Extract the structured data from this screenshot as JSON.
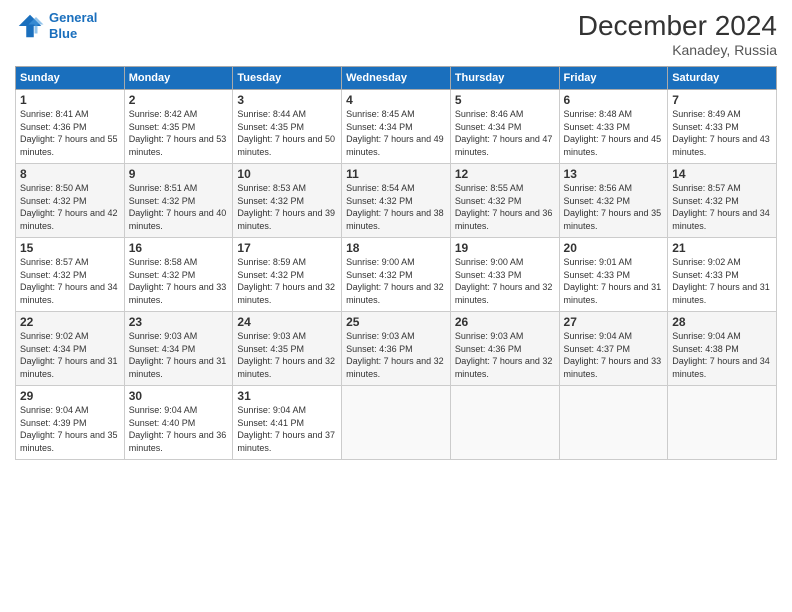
{
  "header": {
    "logo_line1": "General",
    "logo_line2": "Blue",
    "title": "December 2024",
    "subtitle": "Kanadey, Russia"
  },
  "columns": [
    "Sunday",
    "Monday",
    "Tuesday",
    "Wednesday",
    "Thursday",
    "Friday",
    "Saturday"
  ],
  "weeks": [
    [
      {
        "day": "1",
        "sunrise": "Sunrise: 8:41 AM",
        "sunset": "Sunset: 4:36 PM",
        "daylight": "Daylight: 7 hours and 55 minutes."
      },
      {
        "day": "2",
        "sunrise": "Sunrise: 8:42 AM",
        "sunset": "Sunset: 4:35 PM",
        "daylight": "Daylight: 7 hours and 53 minutes."
      },
      {
        "day": "3",
        "sunrise": "Sunrise: 8:44 AM",
        "sunset": "Sunset: 4:35 PM",
        "daylight": "Daylight: 7 hours and 50 minutes."
      },
      {
        "day": "4",
        "sunrise": "Sunrise: 8:45 AM",
        "sunset": "Sunset: 4:34 PM",
        "daylight": "Daylight: 7 hours and 49 minutes."
      },
      {
        "day": "5",
        "sunrise": "Sunrise: 8:46 AM",
        "sunset": "Sunset: 4:34 PM",
        "daylight": "Daylight: 7 hours and 47 minutes."
      },
      {
        "day": "6",
        "sunrise": "Sunrise: 8:48 AM",
        "sunset": "Sunset: 4:33 PM",
        "daylight": "Daylight: 7 hours and 45 minutes."
      },
      {
        "day": "7",
        "sunrise": "Sunrise: 8:49 AM",
        "sunset": "Sunset: 4:33 PM",
        "daylight": "Daylight: 7 hours and 43 minutes."
      }
    ],
    [
      {
        "day": "8",
        "sunrise": "Sunrise: 8:50 AM",
        "sunset": "Sunset: 4:32 PM",
        "daylight": "Daylight: 7 hours and 42 minutes."
      },
      {
        "day": "9",
        "sunrise": "Sunrise: 8:51 AM",
        "sunset": "Sunset: 4:32 PM",
        "daylight": "Daylight: 7 hours and 40 minutes."
      },
      {
        "day": "10",
        "sunrise": "Sunrise: 8:53 AM",
        "sunset": "Sunset: 4:32 PM",
        "daylight": "Daylight: 7 hours and 39 minutes."
      },
      {
        "day": "11",
        "sunrise": "Sunrise: 8:54 AM",
        "sunset": "Sunset: 4:32 PM",
        "daylight": "Daylight: 7 hours and 38 minutes."
      },
      {
        "day": "12",
        "sunrise": "Sunrise: 8:55 AM",
        "sunset": "Sunset: 4:32 PM",
        "daylight": "Daylight: 7 hours and 36 minutes."
      },
      {
        "day": "13",
        "sunrise": "Sunrise: 8:56 AM",
        "sunset": "Sunset: 4:32 PM",
        "daylight": "Daylight: 7 hours and 35 minutes."
      },
      {
        "day": "14",
        "sunrise": "Sunrise: 8:57 AM",
        "sunset": "Sunset: 4:32 PM",
        "daylight": "Daylight: 7 hours and 34 minutes."
      }
    ],
    [
      {
        "day": "15",
        "sunrise": "Sunrise: 8:57 AM",
        "sunset": "Sunset: 4:32 PM",
        "daylight": "Daylight: 7 hours and 34 minutes."
      },
      {
        "day": "16",
        "sunrise": "Sunrise: 8:58 AM",
        "sunset": "Sunset: 4:32 PM",
        "daylight": "Daylight: 7 hours and 33 minutes."
      },
      {
        "day": "17",
        "sunrise": "Sunrise: 8:59 AM",
        "sunset": "Sunset: 4:32 PM",
        "daylight": "Daylight: 7 hours and 32 minutes."
      },
      {
        "day": "18",
        "sunrise": "Sunrise: 9:00 AM",
        "sunset": "Sunset: 4:32 PM",
        "daylight": "Daylight: 7 hours and 32 minutes."
      },
      {
        "day": "19",
        "sunrise": "Sunrise: 9:00 AM",
        "sunset": "Sunset: 4:33 PM",
        "daylight": "Daylight: 7 hours and 32 minutes."
      },
      {
        "day": "20",
        "sunrise": "Sunrise: 9:01 AM",
        "sunset": "Sunset: 4:33 PM",
        "daylight": "Daylight: 7 hours and 31 minutes."
      },
      {
        "day": "21",
        "sunrise": "Sunrise: 9:02 AM",
        "sunset": "Sunset: 4:33 PM",
        "daylight": "Daylight: 7 hours and 31 minutes."
      }
    ],
    [
      {
        "day": "22",
        "sunrise": "Sunrise: 9:02 AM",
        "sunset": "Sunset: 4:34 PM",
        "daylight": "Daylight: 7 hours and 31 minutes."
      },
      {
        "day": "23",
        "sunrise": "Sunrise: 9:03 AM",
        "sunset": "Sunset: 4:34 PM",
        "daylight": "Daylight: 7 hours and 31 minutes."
      },
      {
        "day": "24",
        "sunrise": "Sunrise: 9:03 AM",
        "sunset": "Sunset: 4:35 PM",
        "daylight": "Daylight: 7 hours and 32 minutes."
      },
      {
        "day": "25",
        "sunrise": "Sunrise: 9:03 AM",
        "sunset": "Sunset: 4:36 PM",
        "daylight": "Daylight: 7 hours and 32 minutes."
      },
      {
        "day": "26",
        "sunrise": "Sunrise: 9:03 AM",
        "sunset": "Sunset: 4:36 PM",
        "daylight": "Daylight: 7 hours and 32 minutes."
      },
      {
        "day": "27",
        "sunrise": "Sunrise: 9:04 AM",
        "sunset": "Sunset: 4:37 PM",
        "daylight": "Daylight: 7 hours and 33 minutes."
      },
      {
        "day": "28",
        "sunrise": "Sunrise: 9:04 AM",
        "sunset": "Sunset: 4:38 PM",
        "daylight": "Daylight: 7 hours and 34 minutes."
      }
    ],
    [
      {
        "day": "29",
        "sunrise": "Sunrise: 9:04 AM",
        "sunset": "Sunset: 4:39 PM",
        "daylight": "Daylight: 7 hours and 35 minutes."
      },
      {
        "day": "30",
        "sunrise": "Sunrise: 9:04 AM",
        "sunset": "Sunset: 4:40 PM",
        "daylight": "Daylight: 7 hours and 36 minutes."
      },
      {
        "day": "31",
        "sunrise": "Sunrise: 9:04 AM",
        "sunset": "Sunset: 4:41 PM",
        "daylight": "Daylight: 7 hours and 37 minutes."
      },
      null,
      null,
      null,
      null
    ]
  ]
}
